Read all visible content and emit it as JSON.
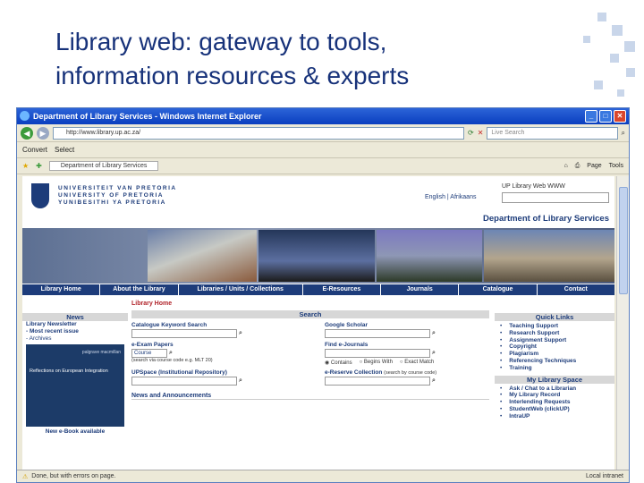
{
  "slide": {
    "title_line1": "Library web: gateway to tools,",
    "title_line2": "information resources & experts"
  },
  "browser": {
    "window_title": "Department of Library Services - Windows Internet Explorer",
    "address": "http://www.library.up.ac.za/",
    "live_search_placeholder": "Live Search",
    "links": [
      "Convert",
      "Select"
    ],
    "tab_label": "Department of Library Services",
    "tools": [
      "Page",
      "Tools"
    ],
    "status_left": "Done, but with errors on page.",
    "status_right": "Local intranet"
  },
  "header": {
    "university_lines": [
      "UNIVERSITEIT VAN PRETORIA",
      "UNIVERSITY OF PRETORIA",
      "YUNIBESITHI YA PRETORIA"
    ],
    "language": "English | Afrikaans",
    "search_scope": "UP Library Web   WWW",
    "department": "Department of Library Services"
  },
  "nav": [
    "Library Home",
    "About the Library",
    "Libraries / Units / Collections",
    "E-Resources",
    "Journals",
    "Catalogue",
    "Contact"
  ],
  "left": {
    "heading": "News",
    "newsletter": "Library Newsletter",
    "recent": "- Most recent issue",
    "archives": "- Archives",
    "book_publisher": "palgrave macmillan",
    "book_title": "Reflections on European Integration",
    "book_caption": "New e-Book available"
  },
  "middle": {
    "breadcrumb": "Library Home",
    "heading": "Search",
    "fields": {
      "catalogue": "Catalogue Keyword Search",
      "scholar": "Google Scholar",
      "exam": "e-Exam Papers",
      "journals": "Find e-Journals",
      "course_value": "Course",
      "exam_hint": "(search via course code e.g. MLT 20)",
      "radio_contains": "Contains",
      "radio_begins": "Begins With",
      "radio_exact": "Exact Match",
      "upspace": "UPSpace (Institutional Repository)",
      "ereserve": "e-Reserve Collection",
      "ereserve_hint": "(search by course code)"
    },
    "news_heading": "News and Announcements"
  },
  "right": {
    "quick_heading": "Quick Links",
    "quick_links": [
      "Teaching Support",
      "Research Support",
      "Assignment Support",
      "Copyright",
      "Plagiarism",
      "Referencing Techniques",
      "Training"
    ],
    "space_heading": "My Library Space",
    "space_links": [
      "Ask / Chat to a Librarian",
      "My Library Record",
      "Interlending Requests",
      "StudentWeb (clickUP)",
      "IntraUP"
    ]
  }
}
